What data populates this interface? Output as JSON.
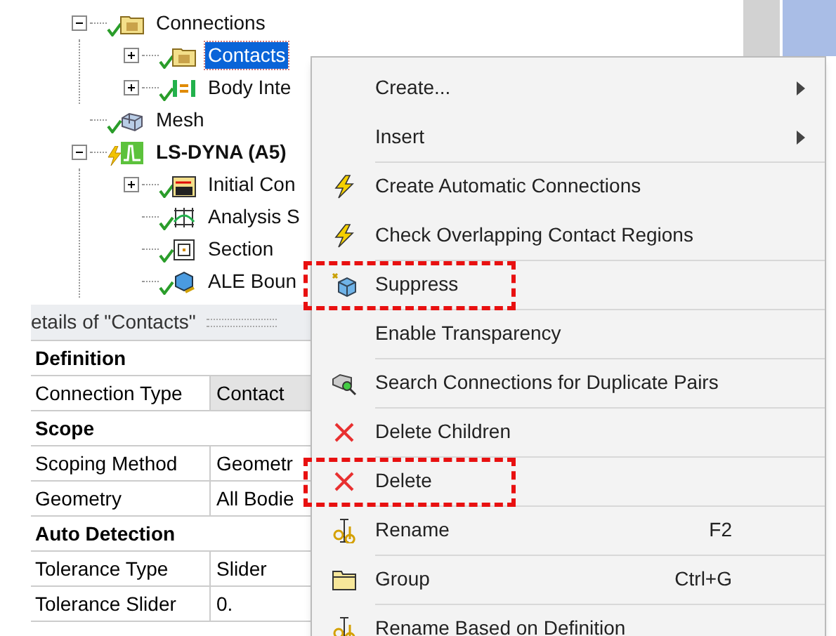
{
  "tree": [
    {
      "label": "Connections",
      "kind": "folder",
      "solved": true,
      "expanded": true,
      "selected": false,
      "children": [
        {
          "label": "Contacts",
          "kind": "contacts",
          "solved": true,
          "expanded": false,
          "selected": true
        },
        {
          "label": "Body Inte",
          "kind": "joint",
          "solved": true,
          "expanded": false,
          "selected": false
        }
      ]
    },
    {
      "label": "Mesh",
      "kind": "mesh",
      "solved": true,
      "selected": false
    },
    {
      "label": "LS-DYNA (A5)",
      "kind": "analysis",
      "solved": false,
      "expanded": true,
      "bold": true,
      "selected": false,
      "children": [
        {
          "label": "Initial Con",
          "kind": "initial",
          "solved": true,
          "expanded": false,
          "selected": false
        },
        {
          "label": "Analysis S",
          "kind": "settings",
          "solved": true,
          "selected": false
        },
        {
          "label": "Section",
          "kind": "section",
          "solved": true,
          "selected": false
        },
        {
          "label": "ALE Boun",
          "kind": "ale",
          "solved": true,
          "selected": false
        }
      ]
    }
  ],
  "details": {
    "title": "etails of \"Contacts\"",
    "rows": [
      {
        "kind": "category",
        "label": "Definition"
      },
      {
        "kind": "property",
        "label": "Connection Type",
        "value": "Contact",
        "readonly": true
      },
      {
        "kind": "category",
        "label": "Scope"
      },
      {
        "kind": "property",
        "label": "Scoping Method",
        "value": "Geometr",
        "readonly": false
      },
      {
        "kind": "property",
        "label": "Geometry",
        "value": "All Bodie",
        "readonly": false
      },
      {
        "kind": "category",
        "label": "Auto Detection"
      },
      {
        "kind": "property",
        "label": "Tolerance Type",
        "value": "Slider",
        "readonly": false
      },
      {
        "kind": "property",
        "label": "Tolerance Slider",
        "value": "0.",
        "readonly": false
      }
    ]
  },
  "context_menu": [
    {
      "label": "Create...",
      "kind": "plain",
      "submenu": true,
      "separator_before": false,
      "highlighted": false
    },
    {
      "label": "Insert",
      "kind": "plain",
      "submenu": true,
      "separator_before": false,
      "highlighted": false
    },
    {
      "label": "Create Automatic Connections",
      "kind": "lightning",
      "separator_before": true,
      "highlighted": false
    },
    {
      "label": "Check Overlapping Contact Regions",
      "kind": "lightning",
      "separator_before": false,
      "highlighted": false
    },
    {
      "label": "Suppress",
      "kind": "suppress",
      "separator_before": true,
      "highlighted": true
    },
    {
      "label": "Enable Transparency",
      "kind": "plain",
      "separator_before": true,
      "highlighted": false
    },
    {
      "label": "Search Connections for Duplicate Pairs",
      "kind": "search",
      "separator_before": true,
      "highlighted": false
    },
    {
      "label": "Delete Children",
      "kind": "delete",
      "separator_before": true,
      "highlighted": false
    },
    {
      "label": "Delete",
      "kind": "delete",
      "separator_before": true,
      "highlighted": true
    },
    {
      "label": "Rename",
      "kind": "rename",
      "shortcut": "F2",
      "separator_before": true,
      "highlighted": false
    },
    {
      "label": "Group",
      "kind": "folder",
      "shortcut": "Ctrl+G",
      "separator_before": true,
      "highlighted": false
    },
    {
      "label": "Rename Based on Definition",
      "kind": "rename",
      "separator_before": true,
      "highlighted": false
    }
  ]
}
